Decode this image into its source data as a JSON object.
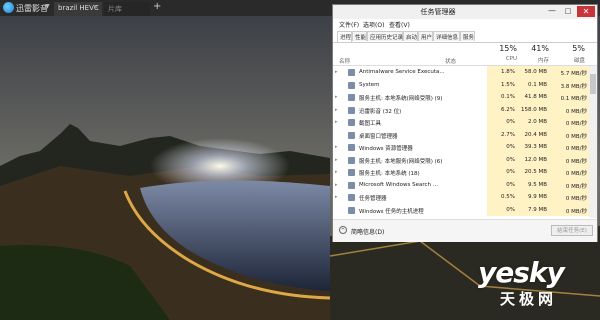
{
  "player": {
    "name": "迅雷影音",
    "tabs": [
      "brazil HEVC",
      "片库"
    ],
    "add_tab": "+"
  },
  "watermark": {
    "main": "yesky",
    "sub": "天极网"
  },
  "task_manager": {
    "title": "任务管理器",
    "controls": {
      "minimize": "—",
      "maximize": "□",
      "close": "✕"
    },
    "menu": [
      "文件(F)",
      "选项(O)",
      "查看(V)"
    ],
    "tabs": [
      "进程",
      "性能",
      "应用历史记录",
      "启动",
      "用户",
      "详细信息",
      "服务"
    ],
    "columns": {
      "name": "名称",
      "status": "状态",
      "cpu": {
        "pct": "15%",
        "label": "CPU"
      },
      "memory": {
        "pct": "41%",
        "label": "内存"
      },
      "disk": {
        "pct": "5%",
        "label": "磁盘"
      }
    },
    "rows": [
      {
        "name": "Antimalware Service Executa...",
        "expandable": true,
        "cpu": "1.8%",
        "mem": "58.0 MB",
        "disk": "5.7 MB/秒"
      },
      {
        "name": "System",
        "expandable": false,
        "cpu": "1.5%",
        "mem": "0.1 MB",
        "disk": "3.8 MB/秒"
      },
      {
        "name": "服务主机: 本地系统(网络受限) (9)",
        "expandable": true,
        "cpu": "0.1%",
        "mem": "41.8 MB",
        "disk": "0.1 MB/秒"
      },
      {
        "name": "迅雷影音 (32 位)",
        "expandable": true,
        "cpu": "6.2%",
        "mem": "158.0 MB",
        "disk": "0 MB/秒"
      },
      {
        "name": "截图工具",
        "expandable": true,
        "cpu": "0%",
        "mem": "2.0 MB",
        "disk": "0 MB/秒"
      },
      {
        "name": "桌面窗口管理器",
        "expandable": false,
        "cpu": "2.7%",
        "mem": "20.4 MB",
        "disk": "0 MB/秒"
      },
      {
        "name": "Windows 资源管理器",
        "expandable": true,
        "cpu": "0%",
        "mem": "39.3 MB",
        "disk": "0 MB/秒"
      },
      {
        "name": "服务主机: 本地服务(网络受限) (6)",
        "expandable": true,
        "cpu": "0%",
        "mem": "12.0 MB",
        "disk": "0 MB/秒"
      },
      {
        "name": "服务主机: 本地系统 (18)",
        "expandable": true,
        "cpu": "0%",
        "mem": "20.5 MB",
        "disk": "0 MB/秒"
      },
      {
        "name": "Microsoft Windows Search ...",
        "expandable": true,
        "cpu": "0%",
        "mem": "9.5 MB",
        "disk": "0 MB/秒"
      },
      {
        "name": "任务管理器",
        "expandable": true,
        "cpu": "0.5%",
        "mem": "9.9 MB",
        "disk": "0 MB/秒"
      },
      {
        "name": "Windows 任务的主机进程",
        "expandable": false,
        "cpu": "0%",
        "mem": "7.9 MB",
        "disk": "0 MB/秒"
      }
    ],
    "footer": {
      "summary": "简略信息(D)",
      "end_task": "结束任务(E)"
    }
  }
}
